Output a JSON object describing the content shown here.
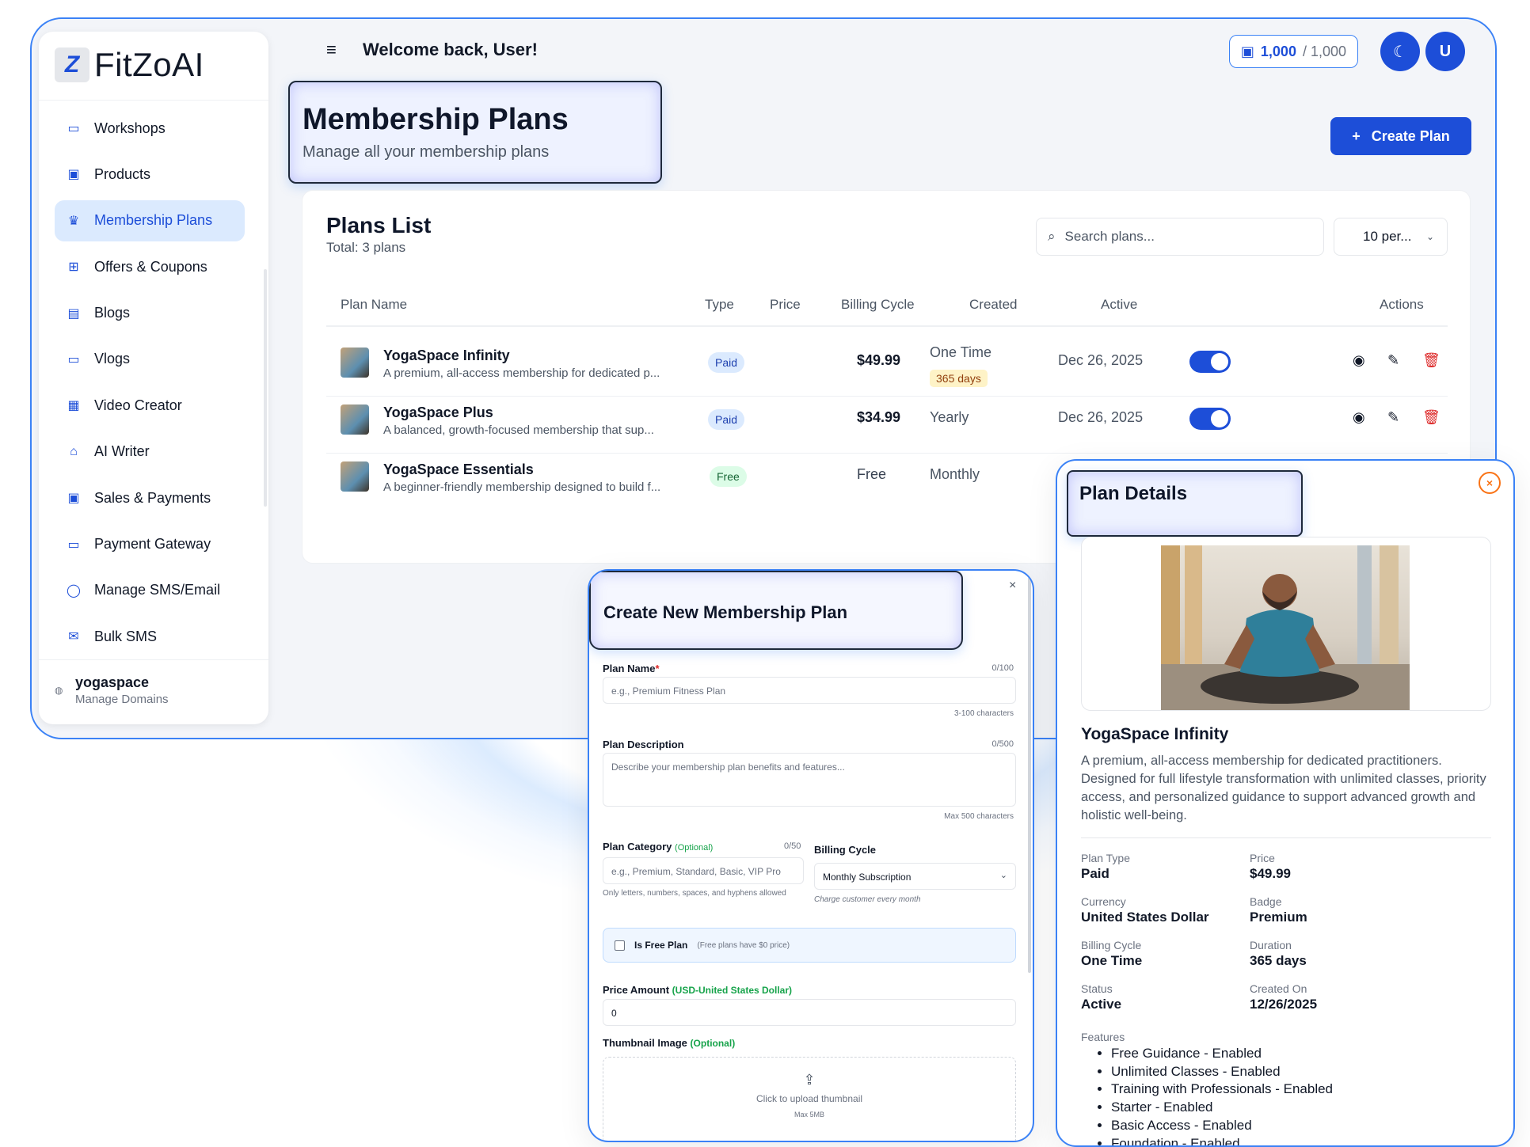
{
  "app": {
    "logo_text": "FitZoAI",
    "logo_mark": "Z",
    "welcome": "Welcome back, User!",
    "credits_used": "1,000",
    "credits_total": "/ 1,000",
    "theme_icon": "moon-icon",
    "avatar_initial": "U"
  },
  "sidebar": {
    "items": [
      {
        "label": "Workshops",
        "icon": "monitor-icon",
        "glyph": "▭"
      },
      {
        "label": "Products",
        "icon": "calendar-icon",
        "glyph": "▣"
      },
      {
        "label": "Membership Plans",
        "icon": "crown-icon",
        "glyph": "♛"
      },
      {
        "label": "Offers & Coupons",
        "icon": "gift-icon",
        "glyph": "⊞"
      },
      {
        "label": "Blogs",
        "icon": "document-icon",
        "glyph": "▤"
      },
      {
        "label": "Vlogs",
        "icon": "video-icon",
        "glyph": "▭"
      },
      {
        "label": "Video Creator",
        "icon": "clapper-icon",
        "glyph": "▦"
      },
      {
        "label": "AI Writer",
        "icon": "robot-icon",
        "glyph": "⌂"
      },
      {
        "label": "Sales & Payments",
        "icon": "wallet-icon",
        "glyph": "▣"
      },
      {
        "label": "Payment Gateway",
        "icon": "credit-card-icon",
        "glyph": "▭"
      },
      {
        "label": "Manage SMS/Email",
        "icon": "chat-icon",
        "glyph": "◯"
      },
      {
        "label": "Bulk SMS",
        "icon": "mail-icon",
        "glyph": "✉"
      }
    ],
    "active_index": 2,
    "workspace_name": "yogaspace",
    "workspace_sub": "Manage Domains"
  },
  "page": {
    "title": "Membership Plans",
    "subtitle": "Manage all your membership plans",
    "create_label": "Create Plan"
  },
  "plans": {
    "title": "Plans List",
    "total": "Total: 3 plans",
    "search_placeholder": "Search plans...",
    "per_page": "10 per...",
    "columns": {
      "name": "Plan Name",
      "type": "Type",
      "price": "Price",
      "cycle": "Billing Cycle",
      "created": "Created",
      "active": "Active",
      "actions": "Actions"
    },
    "rows": [
      {
        "name": "YogaSpace Infinity",
        "desc": "A premium, all-access membership for dedicated p...",
        "type": "Paid",
        "price": "$49.99",
        "cycle": "One Time",
        "days": "365 days",
        "created": "Dec 26, 2025",
        "active": true
      },
      {
        "name": "YogaSpace Plus",
        "desc": "A balanced, growth-focused membership that sup...",
        "type": "Paid",
        "price": "$34.99",
        "cycle": "Yearly",
        "days": "",
        "created": "Dec 26, 2025",
        "active": true
      },
      {
        "name": "YogaSpace Essentials",
        "desc": "A beginner-friendly membership designed to build f...",
        "type": "Free",
        "price": "Free",
        "cycle": "Monthly",
        "days": "",
        "created": "",
        "active": null
      }
    ]
  },
  "create_modal": {
    "title": "Create New Membership Plan",
    "close": "×",
    "plan_name_label": "Plan Name",
    "required_mark": "*",
    "plan_name_count": "0/100",
    "plan_name_placeholder": "e.g., Premium Fitness Plan",
    "plan_name_hint": "3-100 characters",
    "desc_label": "Plan Description",
    "desc_count": "0/500",
    "desc_placeholder": "Describe your membership plan benefits and features...",
    "desc_hint": "Max 500 characters",
    "category_label": "Plan Category",
    "optional": "(Optional)",
    "category_count": "0/50",
    "category_placeholder": "e.g., Premium, Standard, Basic, VIP Pro",
    "category_hint": "Only letters, numbers, spaces, and hyphens allowed",
    "billing_label": "Billing Cycle",
    "billing_value": "Monthly Subscription",
    "billing_hint": "Charge customer every month",
    "free_label": "Is Free Plan",
    "free_hint": "(Free plans have $0 price)",
    "price_label": "Price Amount",
    "price_currency": "(USD-United States Dollar)",
    "price_value": "0",
    "thumb_label": "Thumbnail Image",
    "upload_text": "Click to upload thumbnail",
    "upload_max": "Max 5MB"
  },
  "details_modal": {
    "title": "Plan Details",
    "name": "YogaSpace Infinity",
    "description": "A premium, all-access membership for dedicated practitioners. Designed for full lifestyle transformation with unlimited classes, priority access, and personalized guidance to support advanced growth and holistic well-being.",
    "fields": [
      {
        "label": "Plan Type",
        "value": "Paid"
      },
      {
        "label": "Price",
        "value": "$49.99"
      },
      {
        "label": "Currency",
        "value": "United States Dollar"
      },
      {
        "label": "Badge",
        "value": "Premium"
      },
      {
        "label": "Billing Cycle",
        "value": "One Time"
      },
      {
        "label": "Duration",
        "value": "365 days"
      },
      {
        "label": "Status",
        "value": "Active"
      },
      {
        "label": "Created On",
        "value": "12/26/2025"
      }
    ],
    "features_label": "Features",
    "features": [
      "Free Guidance - Enabled",
      "Unlimited Classes - Enabled",
      "Training with Professionals - Enabled",
      "Starter - Enabled",
      "Basic Access - Enabled",
      "Foundation - Enabled"
    ]
  },
  "colors": {
    "accent": "#1d4ed8",
    "frame": "#3b82f6",
    "free": "#16a34a",
    "danger": "#dc2626"
  }
}
